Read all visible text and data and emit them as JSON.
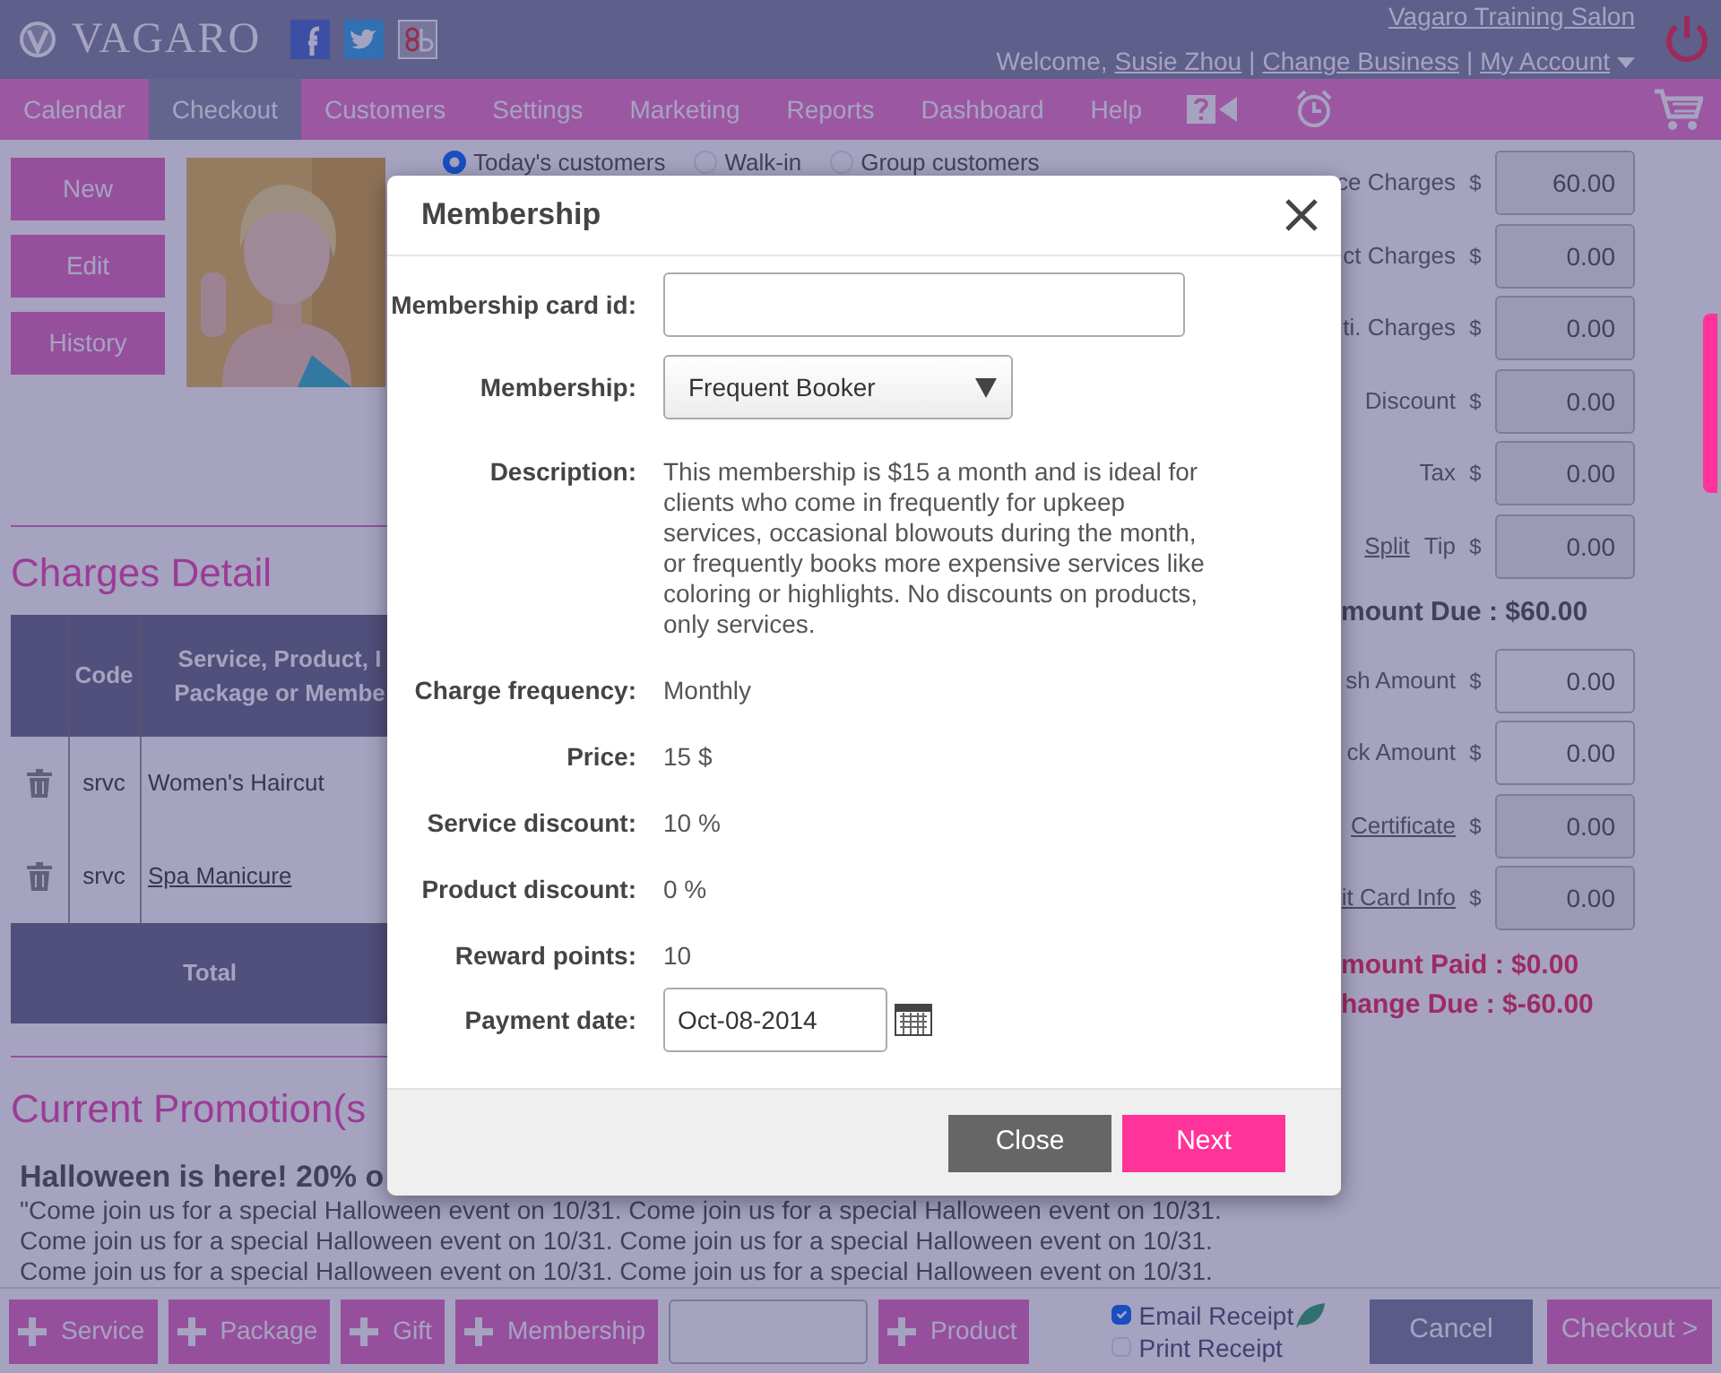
{
  "header": {
    "logo": "VAGARO",
    "salon_link": "Vagaro Training Salon",
    "welcome": "Welcome,",
    "user_link": "Susie Zhou",
    "separator": "|",
    "change_business": "Change Business",
    "my_account": "My Account"
  },
  "nav": [
    {
      "label": "Calendar",
      "selected": false
    },
    {
      "label": "Checkout",
      "selected": true
    },
    {
      "label": "Customers",
      "selected": false
    },
    {
      "label": "Settings",
      "selected": false
    },
    {
      "label": "Marketing",
      "selected": false
    },
    {
      "label": "Reports",
      "selected": false
    },
    {
      "label": "Dashboard",
      "selected": false
    },
    {
      "label": "Help",
      "selected": false
    }
  ],
  "customer_buttons": [
    "New",
    "Edit",
    "History"
  ],
  "customer_types": [
    {
      "label": "Today's customers",
      "selected": true
    },
    {
      "label": "Walk-in",
      "selected": false
    },
    {
      "label": "Group customers",
      "selected": false
    }
  ],
  "charges": {
    "title": "Charges Detail",
    "columns": [
      "Code",
      "Service, Product, I Package or Membe"
    ],
    "rows": [
      {
        "code": "srvc",
        "item": "Women's Haircut",
        "link": false
      },
      {
        "code": "srvc",
        "item": "Spa Manicure",
        "link": true
      }
    ],
    "total": "Total"
  },
  "promotion": {
    "title": "Current Promotion(s",
    "headline": "Halloween is here! 20% o",
    "lines": [
      "\"Come join us for a special Halloween event on 10/31. Come join us for a special Halloween event on 10/31.",
      "Come join us for a special Halloween event on 10/31. Come join us for a special Halloween event on 10/31.",
      "Come join us for a special Halloween event on 10/31. Come join us for a special Halloween event on 10/31."
    ]
  },
  "totals": {
    "charges": [
      {
        "label": "ce Charges",
        "currency": "$",
        "value": "60.00"
      },
      {
        "label": "ct Charges",
        "currency": "$",
        "value": "0.00"
      },
      {
        "label": "ti. Charges",
        "currency": "$",
        "value": "0.00"
      },
      {
        "label": "Discount",
        "currency": "$",
        "value": "0.00"
      },
      {
        "label": "Tax",
        "currency": "$",
        "value": "0.00"
      },
      {
        "link": "Split",
        "label": "Tip",
        "currency": "$",
        "value": "0.00"
      }
    ],
    "amount_due": "mount Due : $60.00",
    "payments": [
      {
        "label": "sh Amount",
        "is_link": false,
        "currency": "$",
        "value": "0.00"
      },
      {
        "label": "ck Amount",
        "is_link": false,
        "currency": "$",
        "value": "0.00"
      },
      {
        "label": "Certificate",
        "is_link": true,
        "currency": "$",
        "value": "0.00"
      },
      {
        "label": "it Card Info",
        "is_link": true,
        "currency": "$",
        "value": "0.00"
      }
    ],
    "amount_paid": "mount Paid : $0.00",
    "change_due": "hange Due : $-60.00"
  },
  "bottom_bar": {
    "items": [
      {
        "kind": "add",
        "label": "Service"
      },
      {
        "kind": "add",
        "label": "Package"
      },
      {
        "kind": "add",
        "label": "Gift"
      },
      {
        "kind": "add",
        "label": "Membership"
      },
      {
        "kind": "field"
      },
      {
        "kind": "add",
        "label": "Product"
      }
    ],
    "receipts": [
      {
        "label": "Email Receipt",
        "checked": true
      },
      {
        "label": "Print Receipt",
        "checked": false
      }
    ],
    "actions": [
      {
        "label": "Cancel",
        "kind": "cancel"
      },
      {
        "label": "Checkout >",
        "kind": "primary"
      }
    ]
  },
  "modal": {
    "title": "Membership",
    "fields": [
      {
        "kind": "input",
        "label": "Membership card id:"
      },
      {
        "kind": "select",
        "label": "Membership:",
        "value": "Frequent Booker"
      },
      {
        "kind": "text",
        "label": "Description:",
        "value": "This membership is $15 a month and is ideal for clients who come in frequently for upkeep services, occasional blowouts during the month, or frequently books more expensive services like coloring or highlights. No discounts on products, only services."
      },
      {
        "kind": "text",
        "label": "Charge frequency:",
        "value": "Monthly"
      },
      {
        "kind": "text",
        "label": "Price:",
        "value": "15 $"
      },
      {
        "kind": "text",
        "label": "Service discount:",
        "value": "10 %"
      },
      {
        "kind": "text",
        "label": "Product discount:",
        "value": "0 %"
      },
      {
        "kind": "text",
        "label": "Reward points:",
        "value": "10"
      },
      {
        "kind": "date",
        "label": "Payment date:",
        "value": "Oct-08-2014"
      }
    ],
    "buttons": [
      {
        "label": "Close",
        "kind": "secondary"
      },
      {
        "label": "Next",
        "kind": "primary"
      }
    ]
  }
}
